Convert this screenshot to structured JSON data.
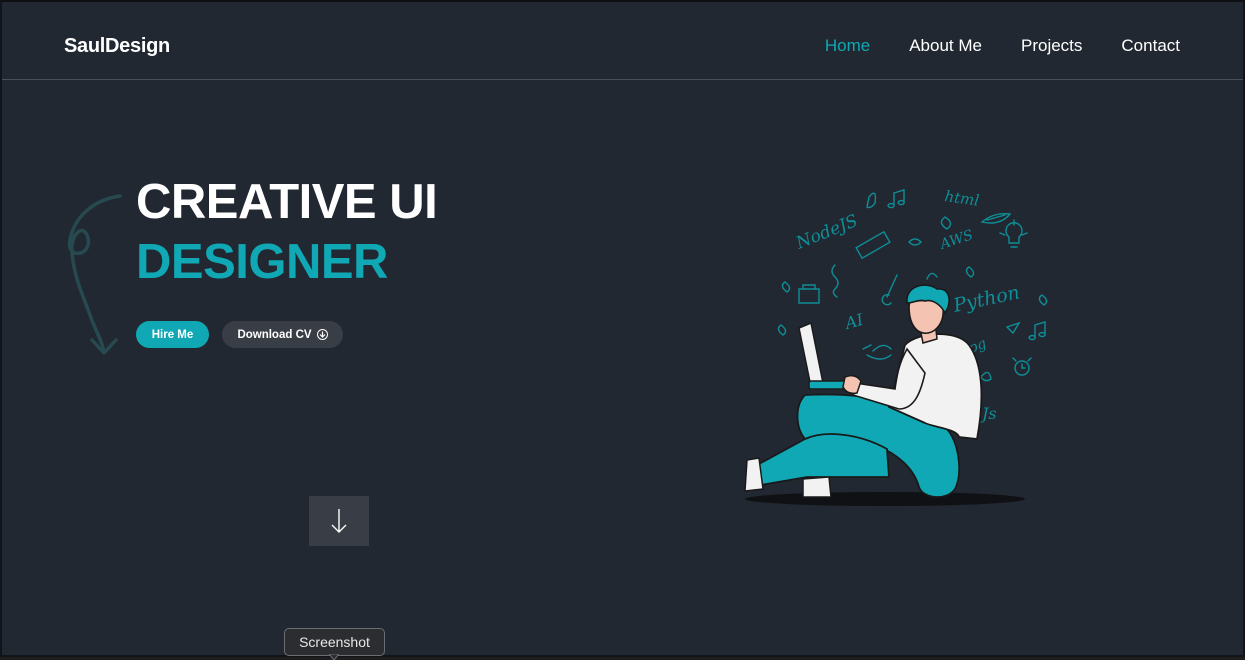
{
  "header": {
    "brand": "SaulDesign",
    "nav": [
      {
        "label": "Home",
        "active": true
      },
      {
        "label": "About Me",
        "active": false
      },
      {
        "label": "Projects",
        "active": false
      },
      {
        "label": "Contact",
        "active": false
      }
    ]
  },
  "hero": {
    "title_line1": "CREATIVE UI",
    "title_line2": "DESIGNER",
    "hire_button": "Hire Me",
    "cv_button": "Download CV",
    "doodle_words": [
      "NodeJS",
      "html",
      "AWS",
      "Python",
      "AI",
      "Js",
      "Jpg"
    ]
  },
  "tooltip": {
    "label": "Screenshot"
  },
  "colors": {
    "background": "#222831",
    "accent": "#10a8b4",
    "button_dark": "#393e46",
    "text": "#ffffff"
  },
  "icons": {
    "scroll": "arrow-down-icon",
    "cv": "download-circle-icon"
  }
}
